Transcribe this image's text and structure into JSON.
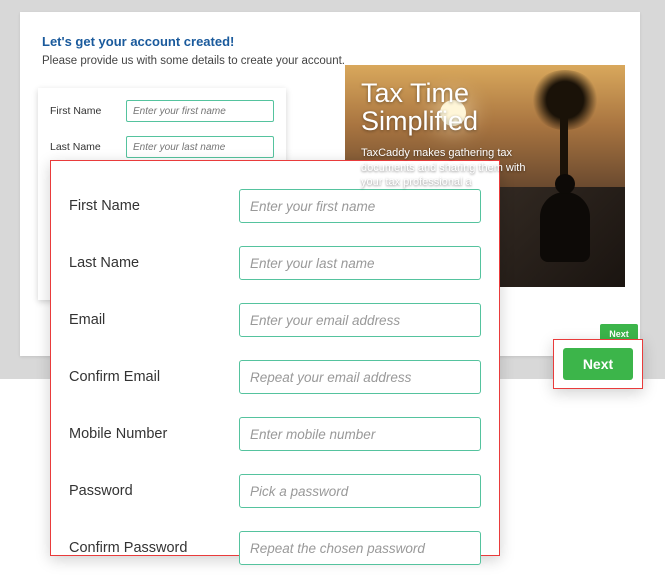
{
  "heading": "Let's get your account created!",
  "subheading": "Please provide us with some details to create your account.",
  "back_form": {
    "first_name": {
      "label": "First Name",
      "placeholder": "Enter your first name"
    },
    "last_name": {
      "label": "Last Name",
      "placeholder": "Enter your last name"
    }
  },
  "promo": {
    "title_line1": "Tax Time",
    "title_line2": "Simplified",
    "subtitle": "TaxCaddy makes gathering tax documents and sharing them with your tax professional a"
  },
  "back_next_label": "Next",
  "form": {
    "first_name": {
      "label": "First Name",
      "placeholder": "Enter your first name"
    },
    "last_name": {
      "label": "Last Name",
      "placeholder": "Enter your last name"
    },
    "email": {
      "label": "Email",
      "placeholder": "Enter your email address"
    },
    "confirm_email": {
      "label": "Confirm Email",
      "placeholder": "Repeat your email address"
    },
    "mobile": {
      "label": "Mobile Number",
      "placeholder": "Enter mobile number"
    },
    "password": {
      "label": "Password",
      "placeholder": "Pick a password"
    },
    "confirm_password": {
      "label": "Confirm Password",
      "placeholder": "Repeat the chosen password"
    }
  },
  "next_label": "Next"
}
